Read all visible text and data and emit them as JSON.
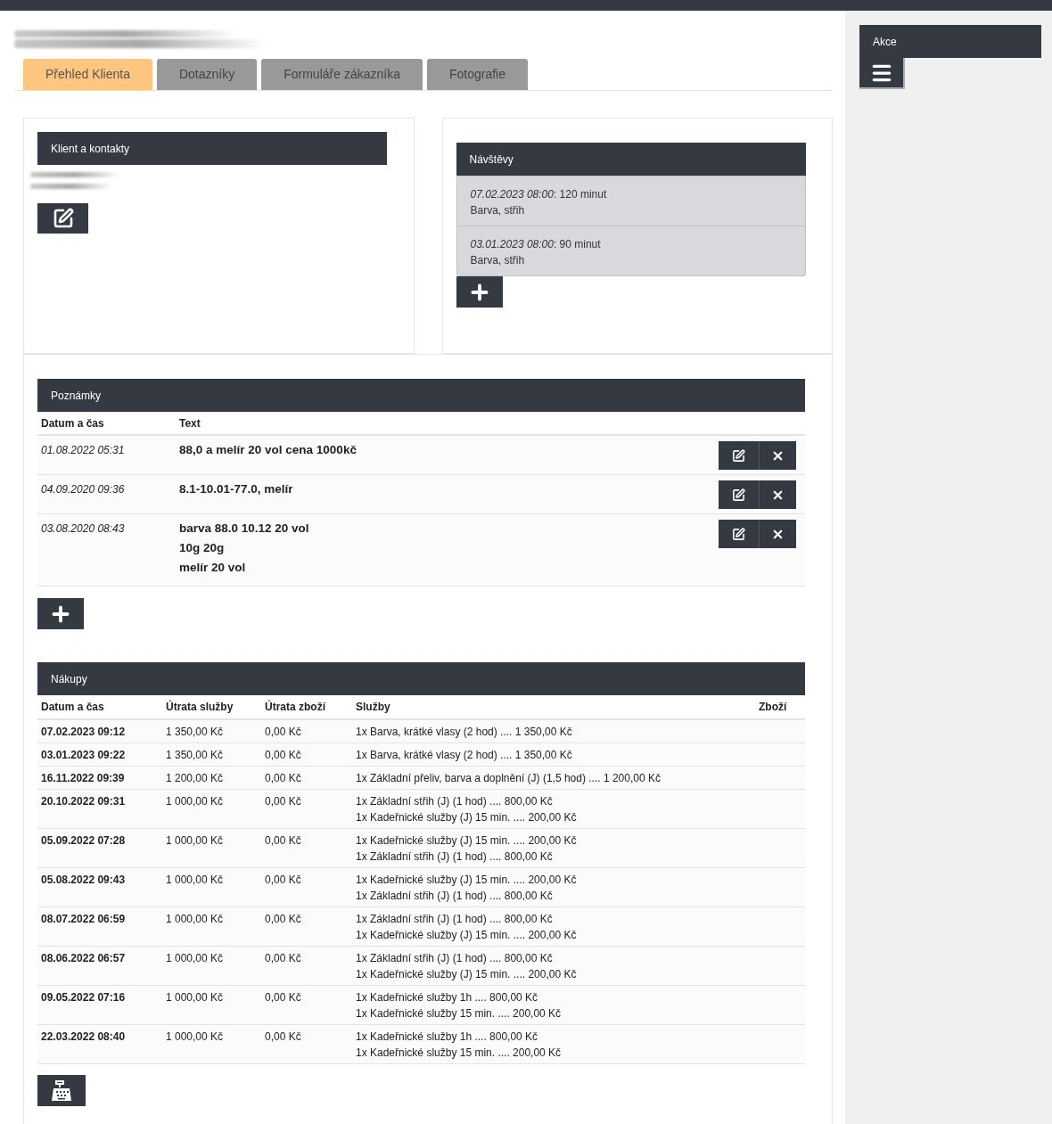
{
  "tabs": [
    {
      "label": "Přehled Klienta",
      "selected": true
    },
    {
      "label": "Dotazníky",
      "selected": false
    },
    {
      "label": "Formuláře zákazníka",
      "selected": false
    },
    {
      "label": "Fotografie",
      "selected": false
    }
  ],
  "client_panel": {
    "title": "Klient a kontakty"
  },
  "visits": {
    "title": "Návštěvy",
    "items": [
      {
        "date": "07.02.2023 08:00",
        "duration": ": 120 minut",
        "services": "Barva, střih"
      },
      {
        "date": "03.01.2023 08:00",
        "duration": ": 90 minut",
        "services": "Barva, střih"
      }
    ]
  },
  "notes": {
    "title": "Poznámky",
    "columns": [
      "Datum a čas",
      "Text"
    ],
    "rows": [
      {
        "date": "01.08.2022 05:31",
        "lines": [
          "88,0 a melír 20 vol cena 1000kč"
        ]
      },
      {
        "date": "04.09.2020 09:36",
        "lines": [
          "8.1-10.01-77.0, melír"
        ]
      },
      {
        "date": "03.08.2020 08:43",
        "lines": [
          "barva 88.0 10.12 20 vol",
          "10g 20g",
          "melír 20 vol"
        ]
      }
    ]
  },
  "purchases": {
    "title": "Nákupy",
    "columns": [
      "Datum a čas",
      "Útrata služby",
      "Útrata zboží",
      "Služby",
      "Zboží"
    ],
    "rows": [
      {
        "date": "07.02.2023 09:12",
        "services_spend": "1 350,00 Kč",
        "goods_spend": "0,00 Kč",
        "services": [
          "1x Barva, krátké vlasy (2 hod) .... 1 350,00 Kč"
        ]
      },
      {
        "date": "03.01.2023 09:22",
        "services_spend": "1 350,00 Kč",
        "goods_spend": "0,00 Kč",
        "services": [
          "1x Barva, krátké vlasy (2 hod) .... 1 350,00 Kč"
        ]
      },
      {
        "date": "16.11.2022 09:39",
        "services_spend": "1 200,00 Kč",
        "goods_spend": "0,00 Kč",
        "services": [
          "1x Základní přeliv, barva a doplnění (J) (1,5 hod) .... 1 200,00 Kč"
        ]
      },
      {
        "date": "20.10.2022 09:31",
        "services_spend": "1 000,00 Kč",
        "goods_spend": "0,00 Kč",
        "services": [
          "1x Základní střih (J) (1 hod) .... 800,00 Kč",
          "1x Kadeřnické služby (J) 15 min. .... 200,00 Kč"
        ]
      },
      {
        "date": "05.09.2022 07:28",
        "services_spend": "1 000,00 Kč",
        "goods_spend": "0,00 Kč",
        "services": [
          "1x Kadeřnické služby (J) 15 min. .... 200,00 Kč",
          "1x Základní střih (J) (1 hod) .... 800,00 Kč"
        ]
      },
      {
        "date": "05.08.2022 09:43",
        "services_spend": "1 000,00 Kč",
        "goods_spend": "0,00 Kč",
        "services": [
          "1x Kadeřnické služby (J) 15 min. .... 200,00 Kč",
          "1x Základní střih (J) (1 hod) .... 800,00 Kč"
        ]
      },
      {
        "date": "08.07.2022 06:59",
        "services_spend": "1 000,00 Kč",
        "goods_spend": "0,00 Kč",
        "services": [
          "1x Základní střih (J) (1 hod) .... 800,00 Kč",
          "1x Kadeřnické služby (J) 15 min. .... 200,00 Kč"
        ]
      },
      {
        "date": "08.06.2022 06:57",
        "services_spend": "1 000,00 Kč",
        "goods_spend": "0,00 Kč",
        "services": [
          "1x Základní střih (J) (1 hod) .... 800,00 Kč",
          "1x Kadeřnické služby (J) 15 min. .... 200,00 Kč"
        ]
      },
      {
        "date": "09.05.2022 07:16",
        "services_spend": "1 000,00 Kč",
        "goods_spend": "0,00 Kč",
        "services": [
          "1x Kadeřnické služby 1h .... 800,00 Kč",
          "1x Kadeřnické služby 15 min. .... 200,00 Kč"
        ]
      },
      {
        "date": "22.03.2022 08:40",
        "services_spend": "1 000,00 Kč",
        "goods_spend": "0,00 Kč",
        "services": [
          "1x Kadeřnické služby 1h .... 800,00 Kč",
          "1x Kadeřnické služby 15 min. .... 200,00 Kč"
        ]
      }
    ]
  },
  "sidebar": {
    "title": "Akce"
  }
}
